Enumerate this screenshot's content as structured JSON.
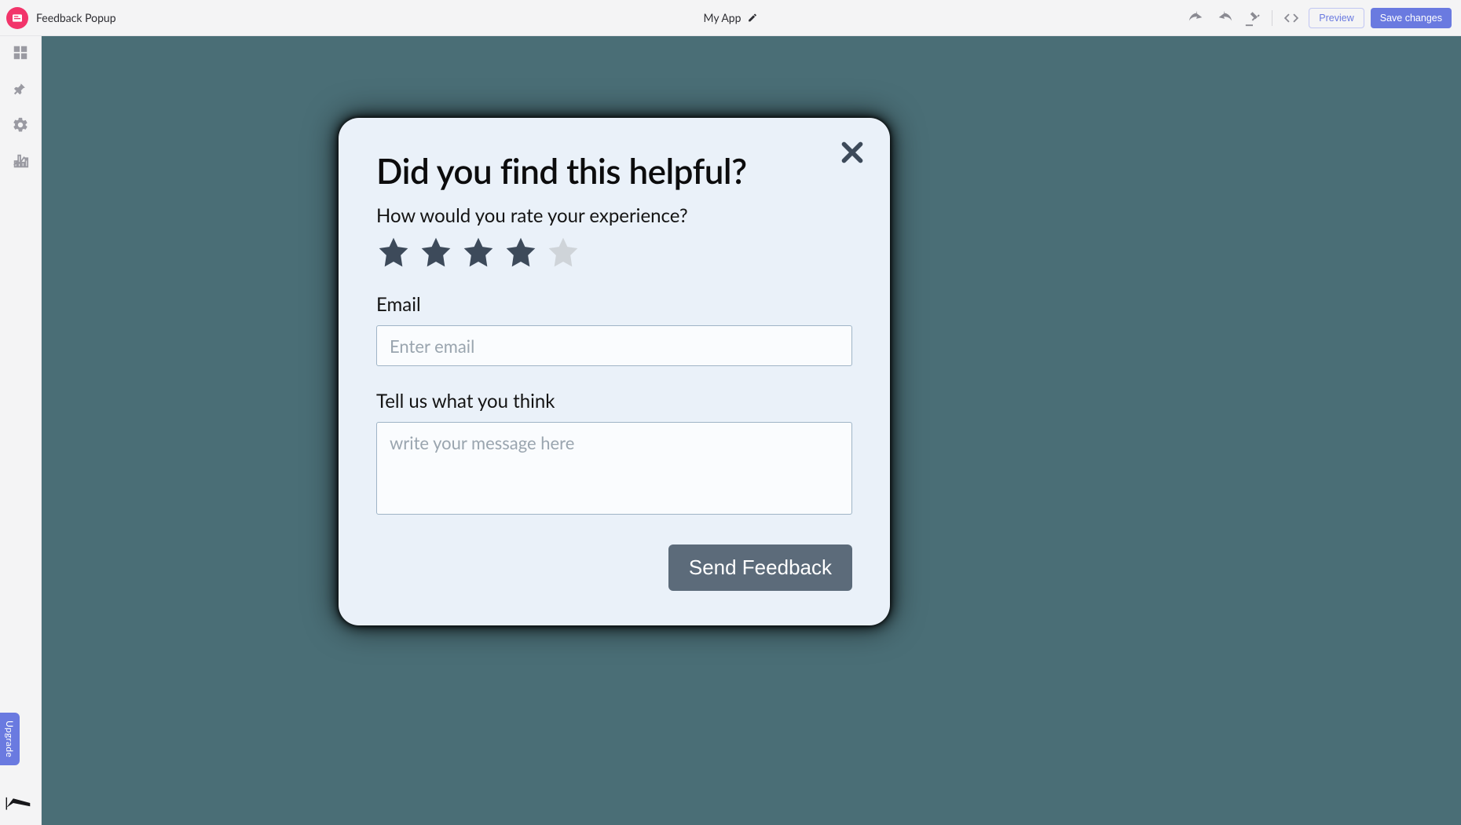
{
  "header": {
    "page_name": "Feedback Popup",
    "app_name": "My App",
    "preview_label": "Preview",
    "save_label": "Save changes"
  },
  "sidebar": {
    "upgrade_label": "Upgrade"
  },
  "popup": {
    "title": "Did you find this helpful?",
    "subtitle": "How would you rate your experience?",
    "rating": 4,
    "max_rating": 5,
    "email_label": "Email",
    "email_placeholder": "Enter email",
    "message_label": "Tell us what you think",
    "message_placeholder": "write your message here",
    "submit_label": "Send Feedback"
  }
}
